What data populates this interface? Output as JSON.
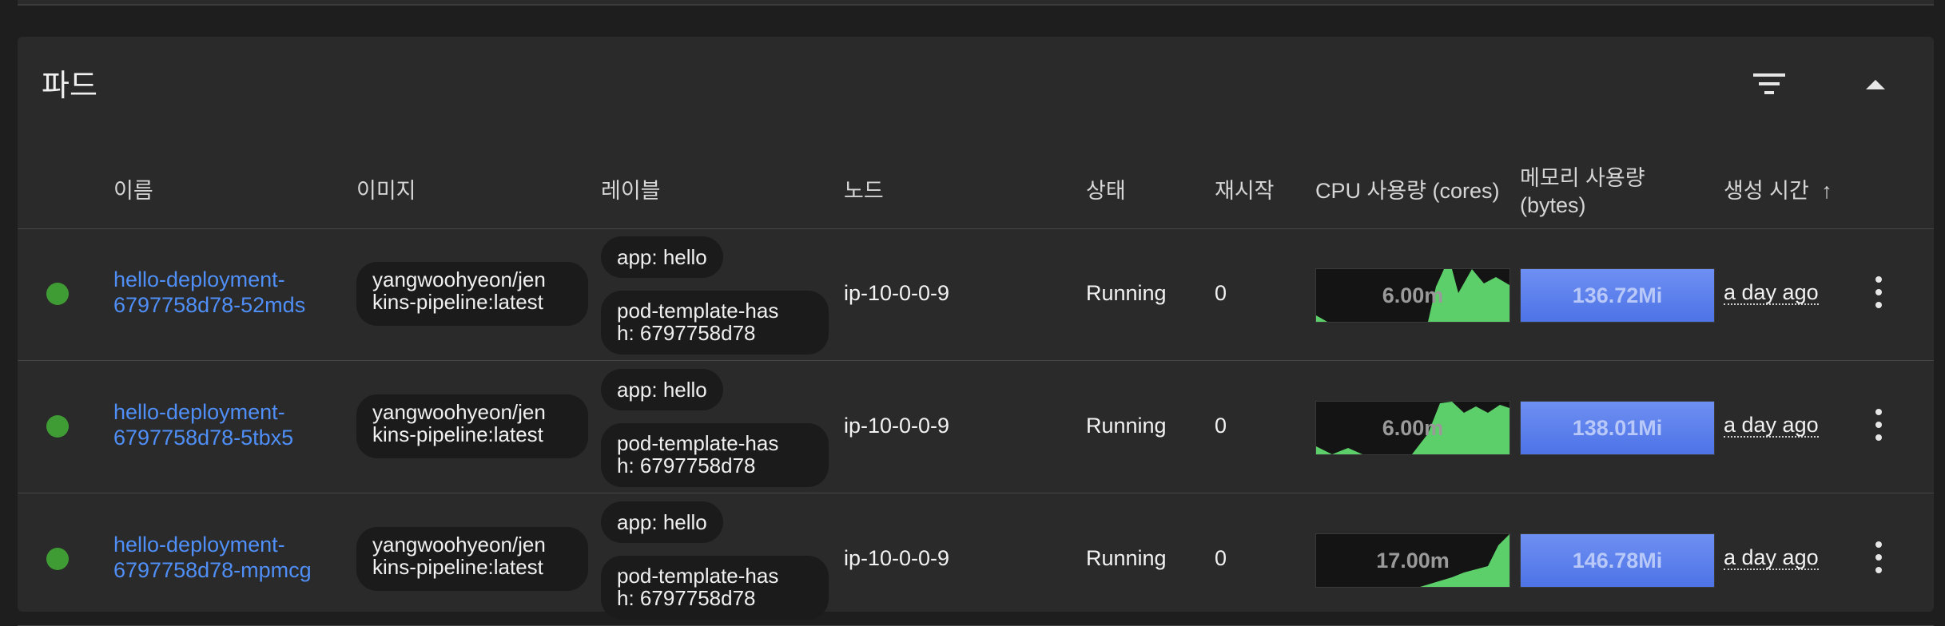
{
  "section_title": "파드",
  "columns": {
    "name": "이름",
    "image": "이미지",
    "labels": "레이블",
    "node": "노드",
    "status": "상태",
    "restarts": "재시작",
    "cpu": "CPU 사용량 (cores)",
    "memory_line1": "메모리 사용량",
    "memory_line2": "(bytes)",
    "created": "생성 시간",
    "sort_indicator": "↑"
  },
  "pods": [
    {
      "name_line1": "hello-deployment-",
      "name_line2": "6797758d78-52mds",
      "image_line1": "yangwoohyeon/jen",
      "image_line2": "kins-pipeline:latest",
      "label1": "app: hello",
      "label2_line1": "pod-template-has",
      "label2_line2": "h: 6797758d78",
      "node": "ip-10-0-0-9",
      "status": "Running",
      "restarts": "0",
      "cpu": "6.00m",
      "memory": "136.72Mi",
      "age": "a day ago"
    },
    {
      "name_line1": "hello-deployment-",
      "name_line2": "6797758d78-5tbx5",
      "image_line1": "yangwoohyeon/jen",
      "image_line2": "kins-pipeline:latest",
      "label1": "app: hello",
      "label2_line1": "pod-template-has",
      "label2_line2": "h: 6797758d78",
      "node": "ip-10-0-0-9",
      "status": "Running",
      "restarts": "0",
      "cpu": "6.00m",
      "memory": "138.01Mi",
      "age": "a day ago"
    },
    {
      "name_line1": "hello-deployment-",
      "name_line2": "6797758d78-mpmcg",
      "image_line1": "yangwoohyeon/jen",
      "image_line2": "kins-pipeline:latest",
      "label1": "app: hello",
      "label2_line1": "pod-template-has",
      "label2_line2": "h: 6797758d78",
      "node": "ip-10-0-0-9",
      "status": "Running",
      "restarts": "0",
      "cpu": "17.00m",
      "memory": "146.78Mi",
      "age": "a day ago"
    }
  ],
  "icons": {
    "filter": "filter-icon",
    "collapse": "collapse-icon",
    "more": "more-vert-icon"
  },
  "colors": {
    "link": "#4f8ff7",
    "status_ok": "#3f9c35",
    "sparkline": "#5ccf6a",
    "memory_bar": "#5b7ff0"
  }
}
